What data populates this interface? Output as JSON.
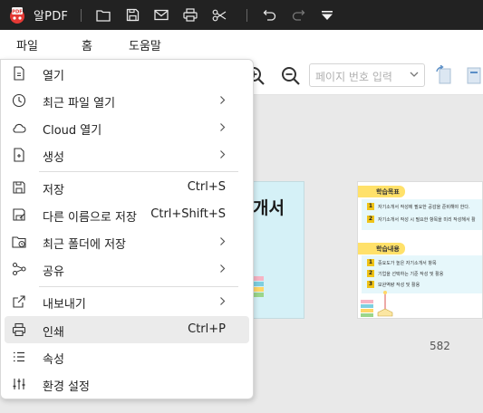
{
  "titlebar": {
    "app_name": "알PDF",
    "logo_text": "PDF",
    "background": "#222222",
    "icons": [
      "folder-icon",
      "save-icon",
      "mail-icon",
      "print-icon",
      "scissors-icon",
      "undo-icon",
      "redo-icon",
      "dropdown-triangle-icon"
    ]
  },
  "menubar": {
    "tabs": [
      "파일",
      "홈",
      "도움말"
    ]
  },
  "toolbar": {
    "page_placeholder": "페이지 번호 입력"
  },
  "document": {
    "page1_title": "개서",
    "page2": {
      "section1_title": "학습목표",
      "section1_items": [
        "자기소개서 작성에 필요한 공감을 준비해야 한다.",
        "자기소개서 작성 시 필요한 항목을 미리 작성해서 활"
      ],
      "section2_title": "학습내용",
      "section2_items": [
        "중요도가 높은 자기소개서 항목",
        "기업을 선택하는 기준 작성 및 활용",
        "보완역량 작성 및 활용"
      ]
    },
    "page_number": "582"
  },
  "file_menu": {
    "items": [
      {
        "label": "열기",
        "shortcut": "",
        "submenu": false,
        "icon": "file-open-icon"
      },
      {
        "label": "최근 파일 열기",
        "shortcut": "",
        "submenu": true,
        "icon": "clock-icon"
      },
      {
        "label": "Cloud 열기",
        "shortcut": "",
        "submenu": true,
        "icon": "cloud-icon"
      },
      {
        "label": "생성",
        "shortcut": "",
        "submenu": true,
        "icon": "file-plus-icon"
      },
      {
        "label": "저장",
        "shortcut": "Ctrl+S",
        "submenu": false,
        "icon": "save-icon"
      },
      {
        "label": "다른 이름으로 저장",
        "shortcut": "Ctrl+Shift+S",
        "submenu": false,
        "icon": "save-as-icon"
      },
      {
        "label": "최근 폴더에 저장",
        "shortcut": "",
        "submenu": true,
        "icon": "folder-clock-icon"
      },
      {
        "label": "공유",
        "shortcut": "",
        "submenu": true,
        "icon": "share-icon"
      },
      {
        "label": "내보내기",
        "shortcut": "",
        "submenu": true,
        "icon": "export-icon"
      },
      {
        "label": "인쇄",
        "shortcut": "Ctrl+P",
        "submenu": false,
        "icon": "print-icon"
      },
      {
        "label": "속성",
        "shortcut": "",
        "submenu": false,
        "icon": "list-icon"
      },
      {
        "label": "환경 설정",
        "shortcut": "",
        "submenu": false,
        "icon": "sliders-icon"
      }
    ],
    "hovered_item": "인쇄"
  }
}
